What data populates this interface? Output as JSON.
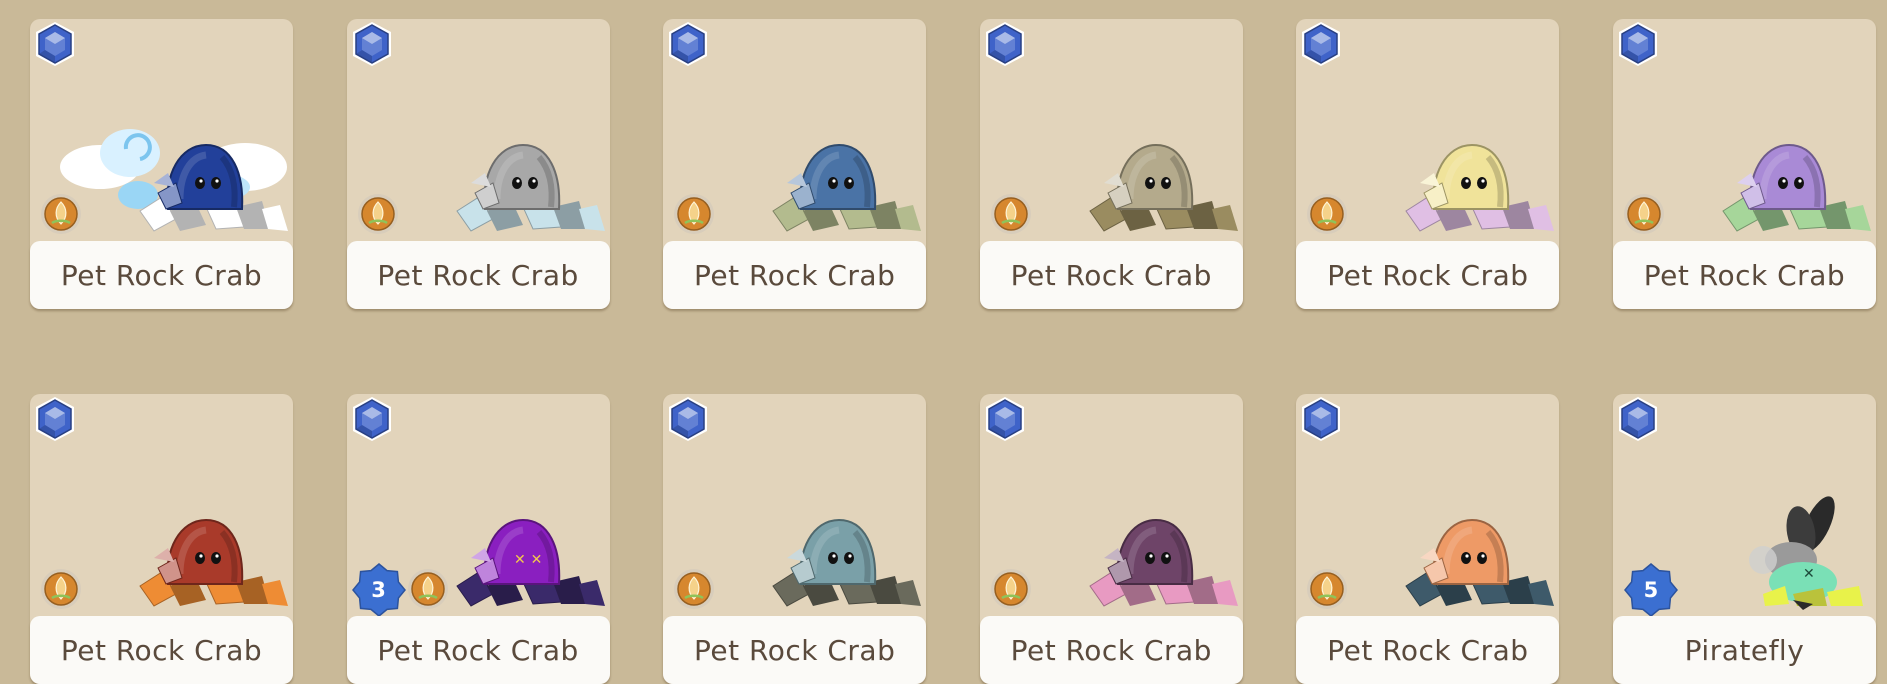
{
  "cards": [
    {
      "name": "Pet Rock Crab",
      "variant": "cloud-blue",
      "body": "#22409a",
      "legs": "#ffffff",
      "coin_icon": "acorn-coin-icon"
    },
    {
      "name": "Pet Rock Crab",
      "variant": "silver",
      "body": "#a8a8a8",
      "legs": "#c8e2ea",
      "coin_icon": "acorn-coin-icon"
    },
    {
      "name": "Pet Rock Crab",
      "variant": "steel-blue",
      "body": "#4a73a6",
      "legs": "#b3bb8e",
      "coin_icon": "acorn-coin-icon"
    },
    {
      "name": "Pet Rock Crab",
      "variant": "khaki",
      "body": "#b4aa8c",
      "legs": "#9a8c60",
      "coin_icon": "acorn-coin-icon"
    },
    {
      "name": "Pet Rock Crab",
      "variant": "pastel-yellow",
      "body": "#f0e39a",
      "legs": "#e0bfe4",
      "coin_icon": "acorn-coin-icon"
    },
    {
      "name": "Pet Rock Crab",
      "variant": "lavender",
      "body": "#a98ad6",
      "legs": "#a6d69a",
      "coin_icon": "acorn-coin-icon"
    },
    {
      "name": "Pet Rock Crab",
      "variant": "red-orange",
      "body": "#a93a2a",
      "legs": "#ee8c34",
      "coin_icon": "acorn-coin-icon"
    },
    {
      "name": "Pet Rock Crab",
      "variant": "purple",
      "body": "#8a1fc0",
      "legs": "#3a2a6a",
      "coin_icon": "acorn-coin-icon",
      "level": "3"
    },
    {
      "name": "Pet Rock Crab",
      "variant": "teal-grey",
      "body": "#7aa0a8",
      "legs": "#6a6a5c",
      "coin_icon": "acorn-coin-icon"
    },
    {
      "name": "Pet Rock Crab",
      "variant": "plum",
      "body": "#6e4468",
      "legs": "#e89ac2",
      "coin_icon": "acorn-coin-icon"
    },
    {
      "name": "Pet Rock Crab",
      "variant": "peach",
      "body": "#ee9a66",
      "legs": "#3e5a6a",
      "coin_icon": "acorn-coin-icon"
    },
    {
      "name": "Piratefly",
      "variant": "mint",
      "body": "#7ae0b6",
      "legs": "#e8f24a",
      "coin_icon": "",
      "level": "5"
    }
  ],
  "colors": {
    "background": "#c9b998",
    "card": "#e2d4bb",
    "label_bg": "#fbfaf7",
    "label_text": "#5a4a3c",
    "gem": "#3f63c9",
    "level_badge": "#3b6fd1",
    "coin": "#d6872e"
  },
  "icons": {
    "gem": "sapphire-gem-icon",
    "coin": "acorn-coin-icon",
    "level": "level-star-badge"
  }
}
